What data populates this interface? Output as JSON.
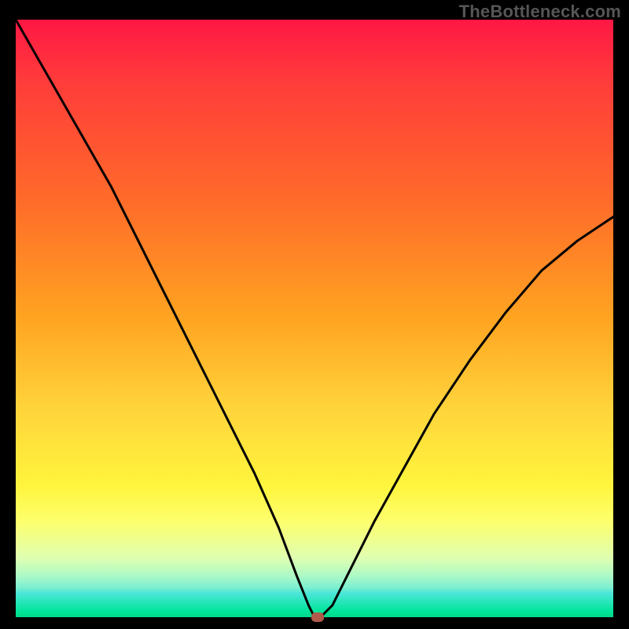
{
  "watermark": "TheBottleneck.com",
  "chart_data": {
    "type": "line",
    "title": "",
    "xlabel": "",
    "ylabel": "",
    "xlim": [
      0,
      100
    ],
    "ylim": [
      0,
      100
    ],
    "grid": false,
    "series": [
      {
        "name": "bottleneck-curve",
        "x": [
          0,
          4,
          8,
          12,
          16,
          20,
          24,
          28,
          32,
          36,
          40,
          44,
          47,
          49,
          50,
          51,
          53,
          56,
          60,
          65,
          70,
          76,
          82,
          88,
          94,
          100
        ],
        "values": [
          100,
          93,
          86,
          79,
          72,
          64,
          56,
          48,
          40,
          32,
          24,
          15,
          7,
          2,
          0,
          0,
          2,
          8,
          16,
          25,
          34,
          43,
          51,
          58,
          63,
          67
        ]
      }
    ],
    "marker": {
      "x": 50.5,
      "y": 0
    },
    "colors": {
      "curve": "#000000",
      "marker": "#b1594a",
      "background_gradient_top": "#ff1744",
      "background_gradient_bottom": "#00d88a"
    }
  }
}
